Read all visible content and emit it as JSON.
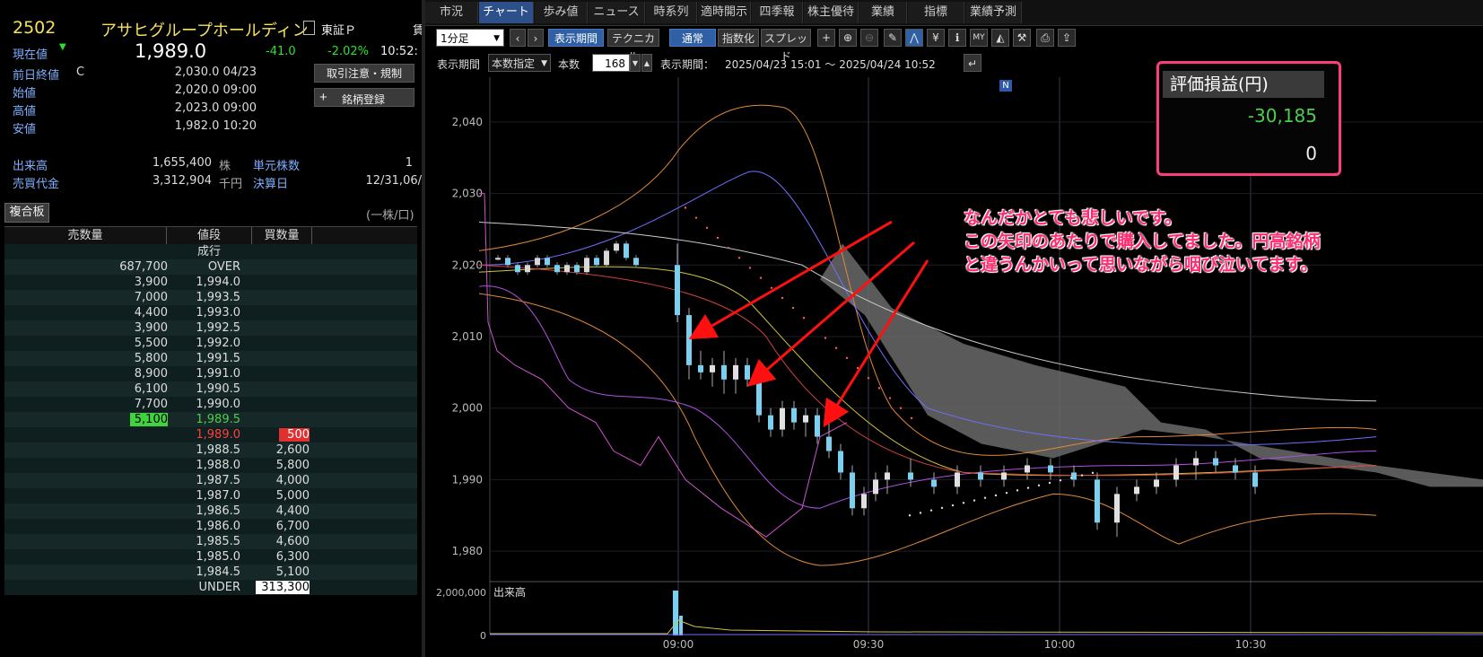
{
  "stock": {
    "code": "2502",
    "name": "アサヒグループホールディン",
    "market": "東証Ｐ",
    "current_label": "現在値",
    "current_price": "1,989.0",
    "change": "-41.0",
    "change_pct": "-2.02%",
    "time": "10:52:",
    "prev_close_label": "前日終値",
    "prev_close_flag": "C",
    "prev_close": "2,030.0 04/23",
    "open_label": "始値",
    "open": "2,020.0 09:00",
    "high_label": "高値",
    "high": "2,023.0 09:00",
    "low_label": "安値",
    "low": "1,982.0 10:20",
    "volume_label": "出来高",
    "volume": "1,655,400",
    "volume_unit": "株",
    "unit_shares_label": "単元株数",
    "unit_shares": "1",
    "turnover_label": "売買代金",
    "turnover": "3,312,904",
    "turnover_unit": "千円",
    "settlement_label": "決算日",
    "settlement": "12/31,06/",
    "notice_button": "取引注意・規制",
    "register_button": "銘柄登録"
  },
  "orderbook": {
    "tab": "複合板",
    "unit_note": "(一株/口)",
    "headers": [
      "売数量",
      "値段",
      "買数量"
    ],
    "market_order": "成行",
    "rows": [
      {
        "sell": "687,700",
        "price": "OVER",
        "buy": ""
      },
      {
        "sell": "3,900",
        "price": "1,994.0",
        "buy": ""
      },
      {
        "sell": "7,000",
        "price": "1,993.5",
        "buy": ""
      },
      {
        "sell": "4,400",
        "price": "1,993.0",
        "buy": ""
      },
      {
        "sell": "3,900",
        "price": "1,992.5",
        "buy": ""
      },
      {
        "sell": "5,500",
        "price": "1,992.0",
        "buy": ""
      },
      {
        "sell": "5,800",
        "price": "1,991.5",
        "buy": ""
      },
      {
        "sell": "8,900",
        "price": "1,991.0",
        "buy": ""
      },
      {
        "sell": "6,100",
        "price": "1,990.5",
        "buy": ""
      },
      {
        "sell": "7,700",
        "price": "1,990.0",
        "buy": ""
      },
      {
        "sell": "5,100",
        "price": "1,989.5",
        "buy": ""
      },
      {
        "sell": "",
        "price": "1,989.0",
        "buy": "500"
      },
      {
        "sell": "",
        "price": "1,988.5",
        "buy": "2,600"
      },
      {
        "sell": "",
        "price": "1,988.0",
        "buy": "5,800"
      },
      {
        "sell": "",
        "price": "1,987.5",
        "buy": "4,000"
      },
      {
        "sell": "",
        "price": "1,987.0",
        "buy": "5,000"
      },
      {
        "sell": "",
        "price": "1,986.5",
        "buy": "4,400"
      },
      {
        "sell": "",
        "price": "1,986.0",
        "buy": "6,700"
      },
      {
        "sell": "",
        "price": "1,985.5",
        "buy": "4,600"
      },
      {
        "sell": "",
        "price": "1,985.0",
        "buy": "6,300"
      },
      {
        "sell": "",
        "price": "1,984.5",
        "buy": "5,100"
      },
      {
        "sell": "",
        "price": "UNDER",
        "buy": "313,300"
      }
    ]
  },
  "tabs": [
    "市況",
    "チャート",
    "歩み値",
    "ニュース",
    "時系列",
    "適時開示",
    "四季報",
    "株主優待",
    "業績",
    "指標",
    "業績予測"
  ],
  "toolbar": {
    "interval": "1分足",
    "prev": "‹",
    "next": "›",
    "period_button": "表示期間",
    "technical_button": "テクニカル",
    "normal_button": "通常",
    "index_button": "指数化",
    "spread_button": "スプレッド",
    "period_label": "表示期間",
    "count_mode": "本数指定",
    "count_label": "本数",
    "count_value": "168",
    "range_label": "表示期間：",
    "range_value": "2025/04/23 15:01 ～ 2025/04/24 10:52"
  },
  "icons": [
    "plus-icon",
    "zoom-in-icon",
    "zoom-out-icon",
    "pencil-icon",
    "line-tool-icon",
    "yen-icon",
    "info-icon",
    "my-icon",
    "chart-area-icon",
    "wrench-icon",
    "print-icon",
    "export-icon"
  ],
  "pnl": {
    "label": "評価損益(円)",
    "value": "-30,185",
    "value2": "0"
  },
  "annotation": {
    "line1": "なんだかとても悲しいです。",
    "line2": "この矢印のあたりで購入してました。円高銘柄",
    "line3": "と違うんかいって思いながら咽び泣いてます。"
  },
  "news_marker": "N",
  "chart_data": {
    "type": "candlestick",
    "ylim": [
      1976,
      2045
    ],
    "y_ticks": [
      "2,040",
      "2,030",
      "2,020",
      "2,010",
      "2,000",
      "1,990",
      "1,980"
    ],
    "x_ticks": [
      "09:00",
      "09:30",
      "10:00",
      "10:30"
    ],
    "volume_label": "出来高",
    "volume_tick": "2,000,000",
    "volume_zero": "0",
    "candles_prev_session_close": [
      2021,
      2020,
      2019,
      2020,
      2021,
      2020,
      2019,
      2020,
      2019,
      2021,
      2020,
      2022,
      2023,
      2021,
      2020
    ],
    "candles_session": [
      {
        "o": 2020,
        "h": 2023,
        "l": 2012,
        "c": 2013
      },
      {
        "o": 2013,
        "h": 2014,
        "l": 2004,
        "c": 2006
      },
      {
        "o": 2006,
        "h": 2008,
        "l": 2004,
        "c": 2005
      },
      {
        "o": 2005,
        "h": 2007,
        "l": 2003,
        "c": 2006
      },
      {
        "o": 2006,
        "h": 2008,
        "l": 2002,
        "c": 2004
      },
      {
        "o": 2004,
        "h": 2007,
        "l": 2002,
        "c": 2006
      },
      {
        "o": 2006,
        "h": 2007,
        "l": 2003,
        "c": 2004
      },
      {
        "o": 2004,
        "h": 2005,
        "l": 1998,
        "c": 1999
      },
      {
        "o": 1999,
        "h": 2000,
        "l": 1996,
        "c": 1997
      },
      {
        "o": 1997,
        "h": 2001,
        "l": 1996,
        "c": 2000
      },
      {
        "o": 2000,
        "h": 2001,
        "l": 1997,
        "c": 1998
      },
      {
        "o": 1998,
        "h": 2000,
        "l": 1996,
        "c": 1999
      },
      {
        "o": 1999,
        "h": 2000,
        "l": 1995,
        "c": 1996
      },
      {
        "o": 1996,
        "h": 1998,
        "l": 1993,
        "c": 1994
      },
      {
        "o": 1994,
        "h": 1995,
        "l": 1990,
        "c": 1991
      },
      {
        "o": 1991,
        "h": 1992,
        "l": 1985,
        "c": 1986
      },
      {
        "o": 1986,
        "h": 1989,
        "l": 1985,
        "c": 1988
      },
      {
        "o": 1988,
        "h": 1991,
        "l": 1987,
        "c": 1990
      },
      {
        "o": 1990,
        "h": 1992,
        "l": 1988,
        "c": 1991
      },
      {
        "o": 1991,
        "h": 1993,
        "l": 1989,
        "c": 1990
      },
      {
        "o": 1990,
        "h": 1991,
        "l": 1988,
        "c": 1989
      },
      {
        "o": 1989,
        "h": 1992,
        "l": 1988,
        "c": 1991
      },
      {
        "o": 1991,
        "h": 1992,
        "l": 1989,
        "c": 1990
      },
      {
        "o": 1990,
        "h": 1992,
        "l": 1989,
        "c": 1991
      },
      {
        "o": 1991,
        "h": 1993,
        "l": 1990,
        "c": 1992
      },
      {
        "o": 1992,
        "h": 1993,
        "l": 1990,
        "c": 1991
      },
      {
        "o": 1991,
        "h": 1992,
        "l": 1989,
        "c": 1990
      },
      {
        "o": 1990,
        "h": 1991,
        "l": 1983,
        "c": 1984
      },
      {
        "o": 1984,
        "h": 1989,
        "l": 1982,
        "c": 1988
      },
      {
        "o": 1988,
        "h": 1990,
        "l": 1987,
        "c": 1989
      },
      {
        "o": 1989,
        "h": 1991,
        "l": 1988,
        "c": 1990
      },
      {
        "o": 1990,
        "h": 1993,
        "l": 1989,
        "c": 1992
      },
      {
        "o": 1992,
        "h": 1994,
        "l": 1990,
        "c": 1993
      },
      {
        "o": 1993,
        "h": 1994,
        "l": 1991,
        "c": 1992
      },
      {
        "o": 1992,
        "h": 1993,
        "l": 1990,
        "c": 1991
      },
      {
        "o": 1991,
        "h": 1992,
        "l": 1988,
        "c": 1989
      }
    ]
  },
  "colors": {
    "accent_blue": "#2f5fa5",
    "up": "#e0e0e0",
    "down": "#7ad0ee",
    "pnl_positive": "#4cd04c",
    "annotation": "#ff2d6f",
    "arrow": "#ff1010",
    "cloud": "#777777"
  }
}
